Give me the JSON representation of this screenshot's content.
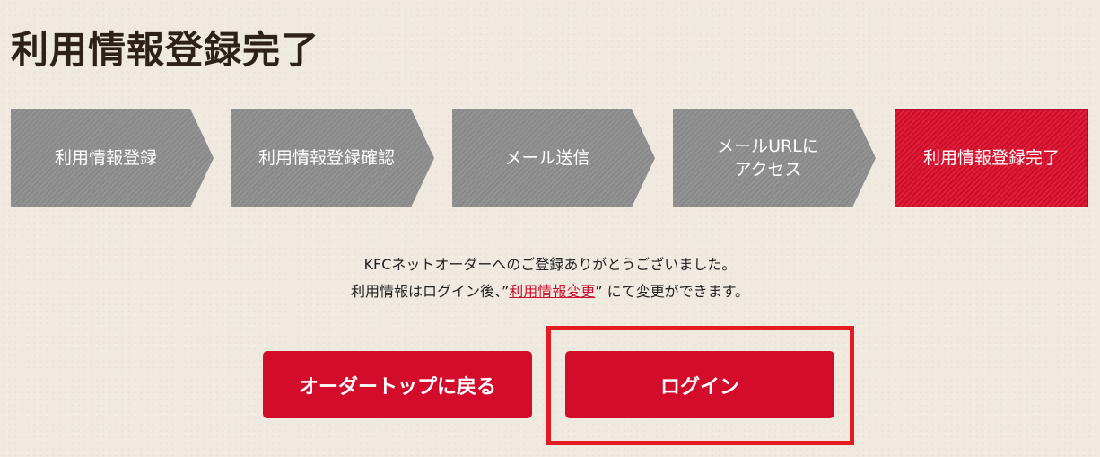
{
  "page": {
    "title": "利用情報登録完了"
  },
  "steps": [
    {
      "label": "利用情報登録",
      "active": false
    },
    {
      "label": "利用情報登録確認",
      "active": false
    },
    {
      "label": "メール送信",
      "active": false
    },
    {
      "label": "メールURLに\nアクセス",
      "active": false
    },
    {
      "label": "利用情報登録完了",
      "active": true
    }
  ],
  "message": {
    "line1": "KFCネットオーダーへのご登録ありがとうございました。",
    "line2_before": "利用情報はログイン後、”",
    "line2_link": "利用情報変更",
    "line2_after": "” にて変更ができます。"
  },
  "buttons": {
    "order_top_label": "オーダートップに戻る",
    "login_label": "ログイン"
  },
  "colors": {
    "accent": "#d40c2c",
    "step_inactive": "#8d8d8d",
    "highlight": "#e31b23"
  }
}
